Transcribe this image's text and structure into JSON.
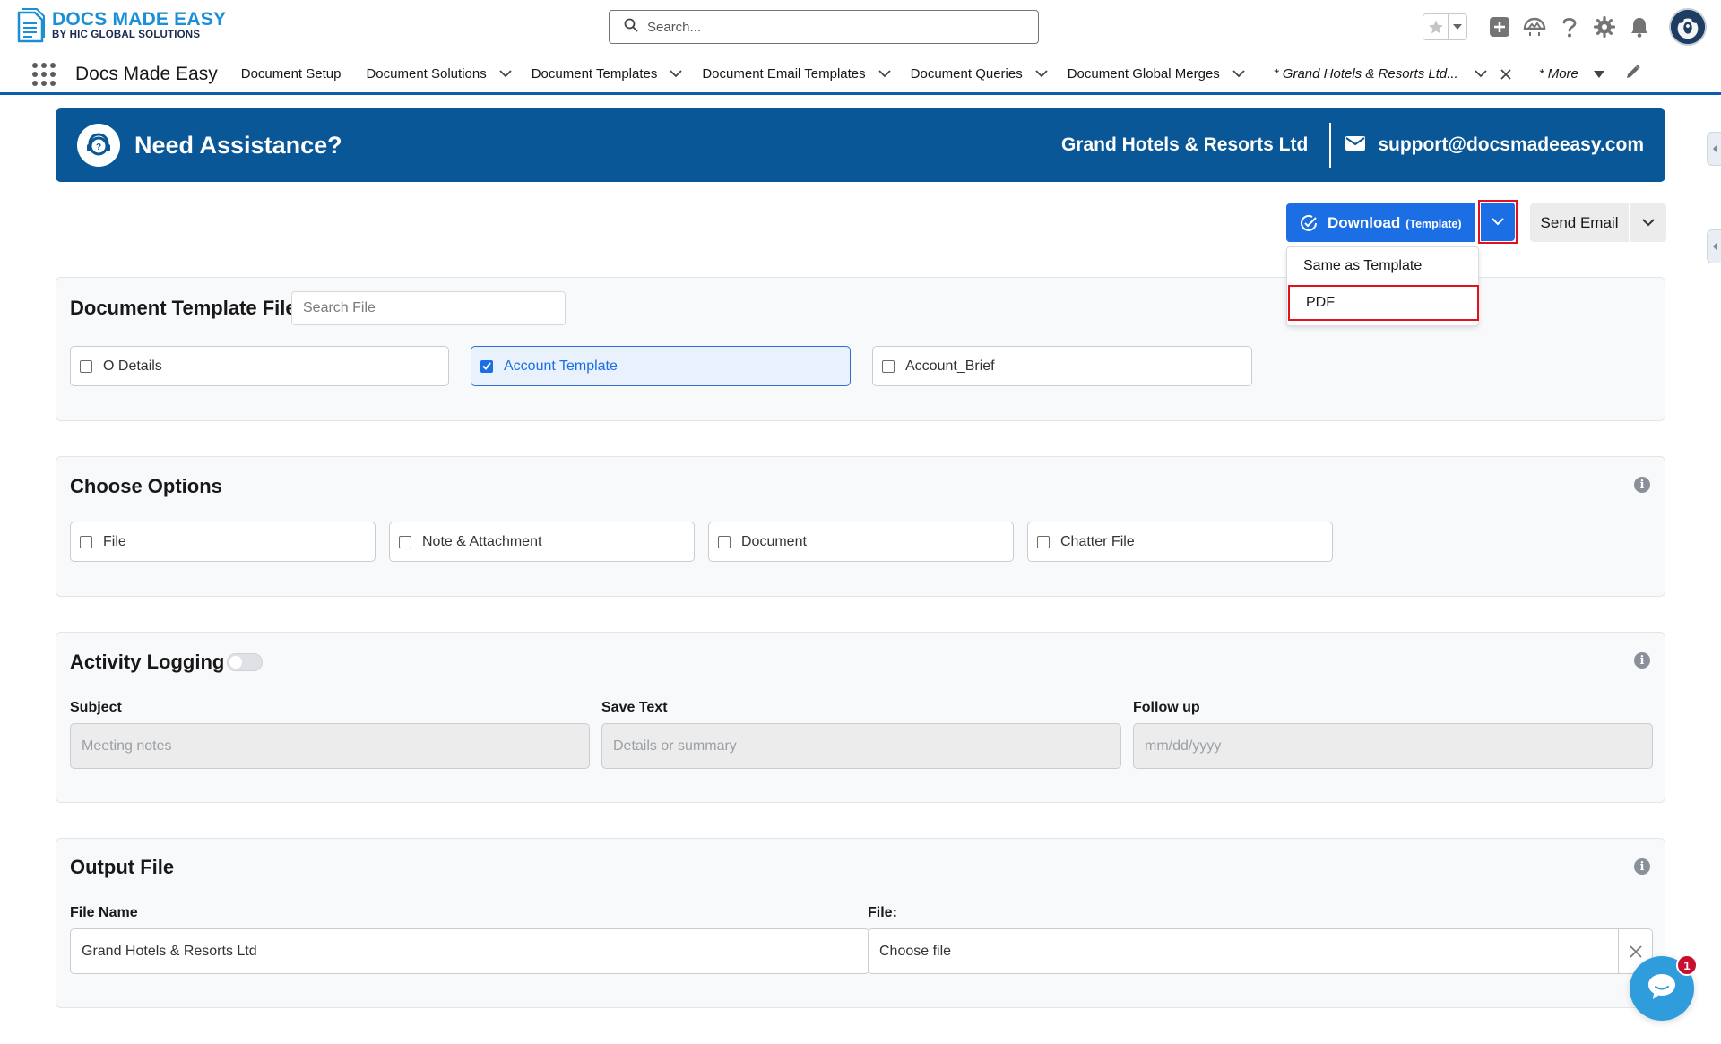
{
  "brand": {
    "logo_title": "DOCS MADE EASY",
    "logo_subtitle": "BY HIC GLOBAL SOLUTIONS"
  },
  "header": {
    "search_placeholder": "Search..."
  },
  "nav": {
    "app_name": "Docs Made Easy",
    "items": [
      {
        "label": "Document Setup",
        "dropdown": false
      },
      {
        "label": "Document Solutions",
        "dropdown": true
      },
      {
        "label": "Document Templates",
        "dropdown": true
      },
      {
        "label": "Document Email Templates",
        "dropdown": true
      },
      {
        "label": "Document Queries",
        "dropdown": true
      },
      {
        "label": "Document Global Merges",
        "dropdown": true
      }
    ],
    "active_tab_label": "* Grand Hotels & Resorts Ltd...",
    "more_label": "* More"
  },
  "banner": {
    "title": "Need Assistance?",
    "company": "Grand Hotels & Resorts Ltd",
    "email": "support@docsmadeeasy.com",
    "bg_color": "#0a5798"
  },
  "actions": {
    "download_label": "Download",
    "download_sublabel": "(Template)",
    "send_email_label": "Send Email",
    "dropdown_options": [
      "Same as Template",
      "PDF"
    ],
    "accent_color": "#1b6ee3",
    "highlight_color": "#e3101e"
  },
  "template_file": {
    "title": "Document Template File",
    "search_placeholder": "Search File",
    "options": [
      {
        "label": "O Details",
        "checked": false
      },
      {
        "label": "Account Template",
        "checked": true
      },
      {
        "label": "Account_Brief",
        "checked": false
      }
    ]
  },
  "choose_options": {
    "title": "Choose Options",
    "options": [
      {
        "label": "File",
        "checked": false
      },
      {
        "label": "Note & Attachment",
        "checked": false
      },
      {
        "label": "Document",
        "checked": false
      },
      {
        "label": "Chatter File",
        "checked": false
      }
    ]
  },
  "activity_logging": {
    "title": "Activity Logging",
    "toggle_on": false,
    "fields": [
      {
        "label": "Subject",
        "placeholder": "Meeting notes"
      },
      {
        "label": "Save Text",
        "placeholder": "Details or summary"
      },
      {
        "label": "Follow up",
        "placeholder": "mm/dd/yyyy"
      }
    ]
  },
  "output_file": {
    "title": "Output File",
    "file_name_label": "File Name",
    "file_name_value": "Grand Hotels & Resorts Ltd",
    "file_label": "File:",
    "file_value": "Choose file"
  },
  "chat": {
    "badge_count": "1"
  }
}
